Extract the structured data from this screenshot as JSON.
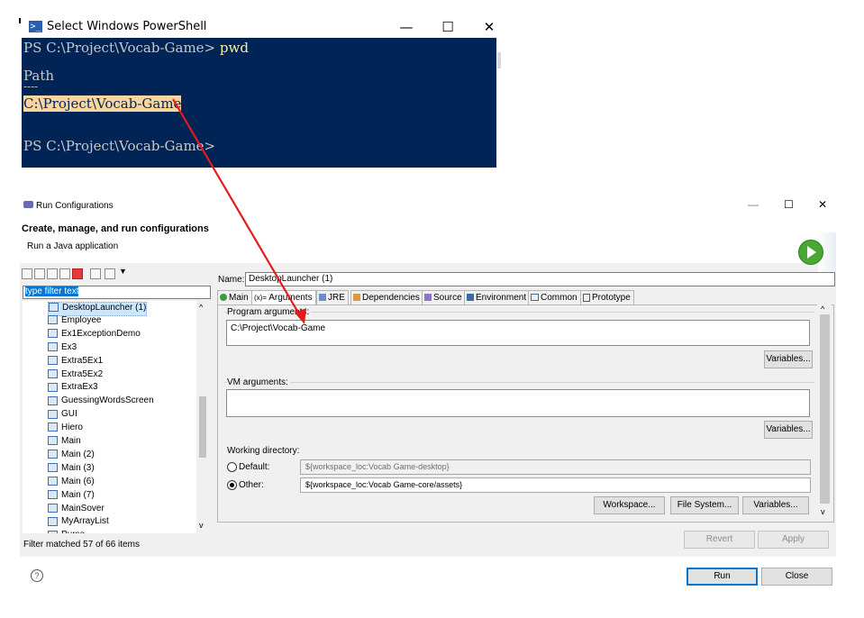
{
  "powershell": {
    "title": "Select Windows PowerShell",
    "icon": "powershell-icon",
    "controls": {
      "minimize": "—",
      "maximize": "☐",
      "close": "✕"
    },
    "lines": {
      "prompt1": "PS C:\\Project\\Vocab-Game> ",
      "cmd1": "pwd",
      "header": "Path",
      "underline": "----",
      "path": "C:\\Project\\Vocab-Game",
      "prompt2": "PS C:\\Project\\Vocab-Game>"
    }
  },
  "dialog": {
    "title": "Run Configurations",
    "controls": {
      "minimize": "—",
      "maximize": "☐",
      "close": "✕"
    },
    "header_title": "Create, manage, and run configurations",
    "header_subtitle": "Run a Java application",
    "filter_placeholder": "type filter text",
    "tree_items": [
      "DesktopLauncher (1)",
      "Employee",
      "Ex1ExceptionDemo",
      "Ex3",
      "Extra5Ex1",
      "Extra5Ex2",
      "ExtraEx3",
      "GuessingWordsScreen",
      "GUI",
      "Hiero",
      "Main",
      "Main (2)",
      "Main (3)",
      "Main (6)",
      "Main (7)",
      "MainSover",
      "MyArrayList",
      "Purse"
    ],
    "filter_status": "Filter matched 57 of 66 items",
    "name_label": "Name:",
    "name_value": "DesktopLauncher (1)",
    "tabs": [
      "Main",
      "Arguments",
      "JRE",
      "Dependencies",
      "Source",
      "Environment",
      "Common",
      "Prototype"
    ],
    "tab_prefixes": {
      "arguments": "(x)="
    },
    "program_args_label": "Program arguments:",
    "program_args_value": "C:\\Project\\Vocab-Game",
    "variables_label": "Variables...",
    "vm_args_label": "VM arguments:",
    "vm_args_value": "",
    "working_dir_label": "Working directory:",
    "default_label": "Default:",
    "default_value": "${workspace_loc:Vocab Game-desktop}",
    "other_label": "Other:",
    "other_value": "${workspace_loc:Vocab Game-core/assets}",
    "workspace_btn": "Workspace...",
    "filesystem_btn": "File System...",
    "revert_btn": "Revert",
    "apply_btn": "Apply",
    "run_btn": "Run",
    "close_btn": "Close",
    "help_glyph": "?"
  },
  "annotation": {
    "color": "#e31b1b"
  }
}
